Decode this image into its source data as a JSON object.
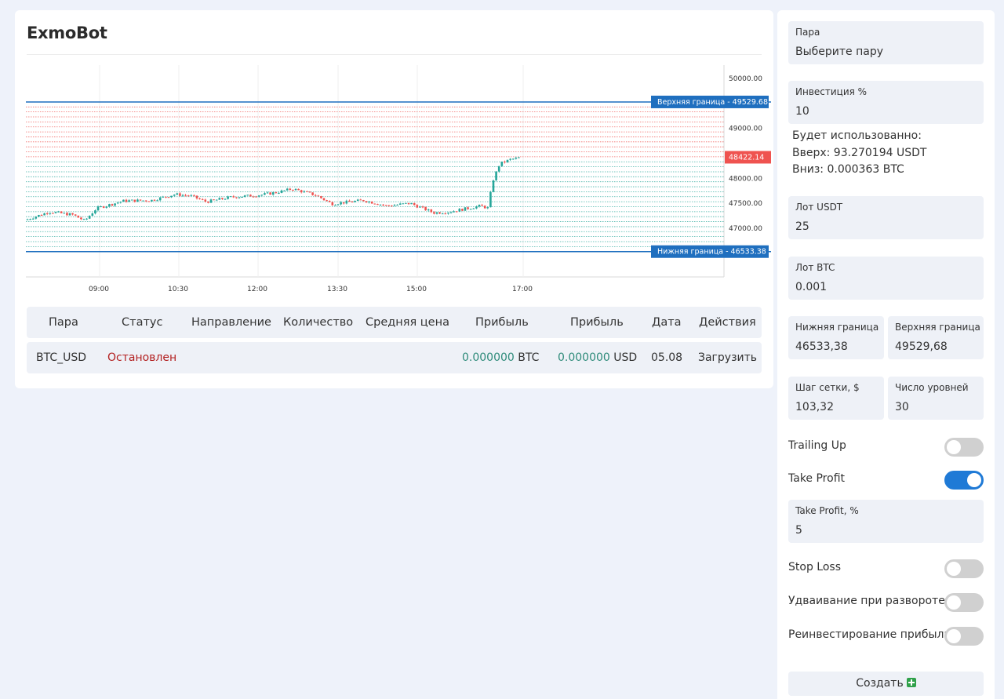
{
  "app": {
    "title": "ExmoBot"
  },
  "chart_data": {
    "type": "candlestick",
    "price_ticks": [
      "50000.00",
      "49000.00",
      "48000.00",
      "47500.00",
      "47000.00"
    ],
    "time_ticks": [
      "09:00",
      "10:30",
      "12:00",
      "13:30",
      "15:00",
      "17:00"
    ],
    "upper_bound": {
      "label": "Верхняя граница",
      "value": "49529.68"
    },
    "lower_bound": {
      "label": "Нижняя граница",
      "value": "46533.38"
    },
    "last_price": "48422.14",
    "grid_levels": 30,
    "colors": {
      "up": "#26a69a",
      "down": "#ef5350",
      "bound": "#1f6fbf",
      "last": "#ef5350"
    }
  },
  "table": {
    "headers": [
      "Пара",
      "Статус",
      "Направление",
      "Количество",
      "Средняя цена",
      "Прибыль",
      "Прибыль",
      "Дата",
      "Действия"
    ],
    "rows": [
      {
        "pair": "BTC_USD",
        "status": "Остановлен",
        "direction": "",
        "quantity": "",
        "avg_price": "",
        "profit_btc_value": "0.000000",
        "profit_btc_unit": "BTC",
        "profit_usd_value": "0.000000",
        "profit_usd_unit": "USD",
        "date": "05.08",
        "action": "Загрузить"
      }
    ]
  },
  "form": {
    "pair": {
      "label": "Пара",
      "value": "Выберите пару"
    },
    "investment": {
      "label": "Инвестиция %",
      "value": "10"
    },
    "usage": {
      "title": "Будет использованно:",
      "up": "Вверх: 93.270194 USDT",
      "down": "Вниз: 0.000363 BTC"
    },
    "lot_usdt": {
      "label": "Лот USDT",
      "value": "25"
    },
    "lot_btc": {
      "label": "Лот BTC",
      "value": "0.001"
    },
    "lower_bound": {
      "label": "Нижняя граница",
      "value": "46533,38"
    },
    "upper_bound": {
      "label": "Верхняя граница",
      "value": "49529,68"
    },
    "grid_step": {
      "label": "Шаг сетки, $",
      "value": "103,32"
    },
    "levels": {
      "label": "Число уровней",
      "value": "30"
    },
    "trailing_up": {
      "label": "Trailing Up",
      "on": false
    },
    "take_profit": {
      "label": "Take Profit",
      "on": true
    },
    "take_profit_pct": {
      "label": "Take Profit, %",
      "value": "5"
    },
    "stop_loss": {
      "label": "Stop Loss",
      "on": false
    },
    "double_on_reversal": {
      "label": "Удваивание при развороте",
      "on": false
    },
    "reinvest": {
      "label": "Реинвестирование прибыли",
      "on": false
    },
    "create_label": "Создать",
    "create_icon": "plus-square-icon"
  }
}
